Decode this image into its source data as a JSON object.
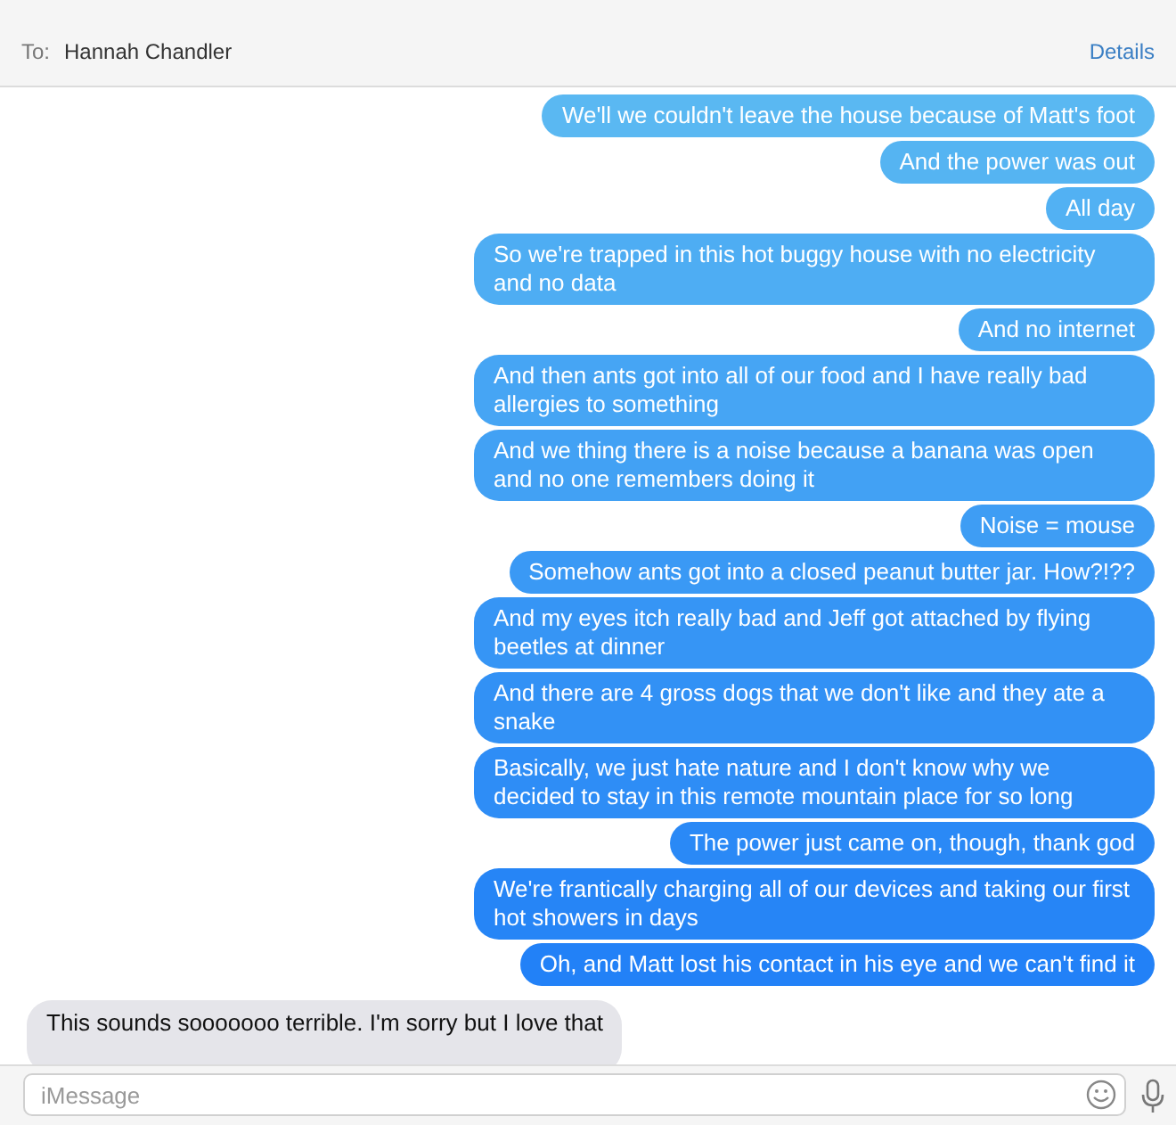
{
  "header": {
    "to_label": "To:",
    "recipient": "Hannah Chandler",
    "details_link": "Details"
  },
  "messages": [
    {
      "kind": "sent",
      "text": "We'll we couldn't leave the house because of Matt's foot"
    },
    {
      "kind": "sent",
      "text": "And the power was out"
    },
    {
      "kind": "sent",
      "text": "All day"
    },
    {
      "kind": "sent",
      "text": "So we're trapped in this hot buggy house with no electricity and no data"
    },
    {
      "kind": "sent",
      "text": "And no internet"
    },
    {
      "kind": "sent",
      "text": "And then ants got into all of our food and I have really bad allergies to something"
    },
    {
      "kind": "sent",
      "text": "And we thing there is a noise because a banana was open and no one remembers doing it"
    },
    {
      "kind": "sent",
      "text": "Noise = mouse"
    },
    {
      "kind": "sent",
      "text": "Somehow ants got into a closed peanut butter jar. How?!??"
    },
    {
      "kind": "sent",
      "text": "And my eyes itch really bad and Jeff got attached by flying beetles at dinner"
    },
    {
      "kind": "sent",
      "text": "And there are 4 gross dogs that we don't like and they ate a snake"
    },
    {
      "kind": "sent",
      "text": "Basically, we just hate nature and I don't know why we decided to stay in this remote mountain place for so long"
    },
    {
      "kind": "sent",
      "text": "The power just came on, though, thank god"
    },
    {
      "kind": "sent",
      "text": "We're frantically charging all of our devices and taking our first hot showers in days"
    },
    {
      "kind": "sent",
      "text": "Oh, and Matt lost his contact in his eye and we can't find it"
    },
    {
      "kind": "received",
      "text": "This sounds sooooooo terrible. I'm sorry but I love that"
    }
  ],
  "composer": {
    "placeholder": "iMessage"
  }
}
